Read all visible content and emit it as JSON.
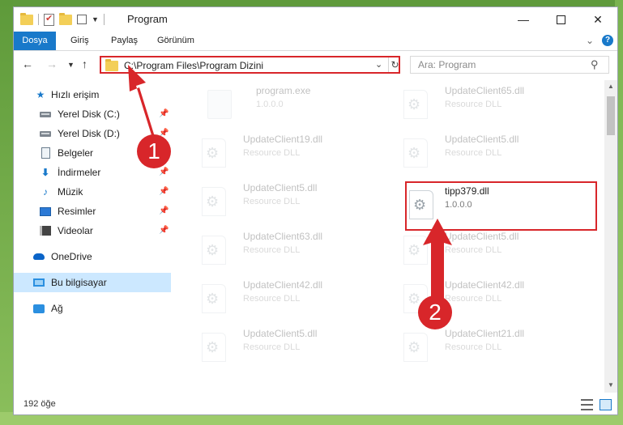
{
  "window": {
    "title": "Program"
  },
  "ribbon": {
    "tabs": [
      "Dosya",
      "Giriş",
      "Paylaş",
      "Görünüm"
    ]
  },
  "address": {
    "path": "C:\\Program Files\\Program Dizini"
  },
  "search": {
    "placeholder": "Ara: Program"
  },
  "sidebar": {
    "items": [
      {
        "label": "Hızlı erişim",
        "icon": "star-icon",
        "pinned": false
      },
      {
        "label": "Yerel Disk (C:)",
        "icon": "drive-icon",
        "pinned": true
      },
      {
        "label": "Yerel Disk (D:)",
        "icon": "drive-icon",
        "pinned": true
      },
      {
        "label": "Belgeler",
        "icon": "documents-icon",
        "pinned": true
      },
      {
        "label": "İndirmeler",
        "icon": "downloads-icon",
        "pinned": true
      },
      {
        "label": "Müzik",
        "icon": "music-icon",
        "pinned": true
      },
      {
        "label": "Resimler",
        "icon": "pictures-icon",
        "pinned": true
      },
      {
        "label": "Videolar",
        "icon": "videos-icon",
        "pinned": true
      },
      {
        "label": "OneDrive",
        "icon": "onedrive-icon",
        "pinned": false
      },
      {
        "label": "Bu bilgisayar",
        "icon": "this-pc-icon",
        "pinned": false,
        "selected": true
      },
      {
        "label": "Ağ",
        "icon": "network-icon",
        "pinned": false
      }
    ]
  },
  "files": {
    "col1": [
      {
        "name": "program.exe",
        "sub": "1.0.0.0"
      },
      {
        "name": "UpdateClient19.dll",
        "sub": "Resource DLL"
      },
      {
        "name": "UpdateClient5.dll",
        "sub": "Resource DLL"
      },
      {
        "name": "UpdateClient63.dll",
        "sub": "Resource DLL"
      },
      {
        "name": "UpdateClient42.dll",
        "sub": "Resource DLL"
      },
      {
        "name": "UpdateClient5.dll",
        "sub": "Resource DLL"
      }
    ],
    "col2": [
      {
        "name": "UpdateClient65.dll",
        "sub": "Resource DLL"
      },
      {
        "name": "UpdateClient5.dll",
        "sub": "Resource DLL"
      },
      {
        "name": "tipp379.dll",
        "sub": "1.0.0.0",
        "highlighted": true
      },
      {
        "name": "UpdateClient5.dll",
        "sub": "Resource DLL"
      },
      {
        "name": "UpdateClient42.dll",
        "sub": "Resource DLL"
      },
      {
        "name": "UpdateClient21.dll",
        "sub": "Resource DLL"
      }
    ]
  },
  "status": {
    "item_count": "192 öğe"
  },
  "annotations": {
    "badge1": "1",
    "badge2": "2",
    "color": "#d8262a"
  },
  "colors": {
    "accent": "#1979ca",
    "selection": "#cce8ff"
  }
}
